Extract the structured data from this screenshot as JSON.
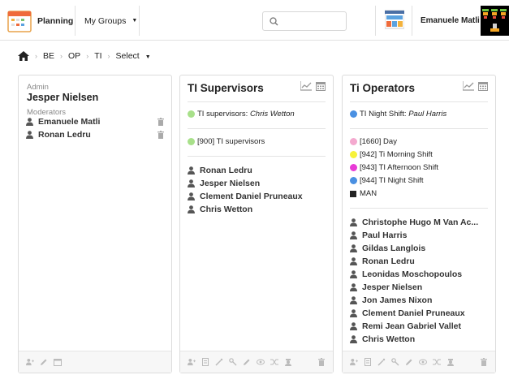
{
  "topbar": {
    "app_name": "Planning",
    "groups_label": "My Groups",
    "search_placeholder": "",
    "user_name": "Emanuele Matli"
  },
  "breadcrumb": {
    "items": [
      "BE",
      "OP",
      "TI"
    ],
    "select_label": "Select"
  },
  "admin_panel": {
    "admin_label": "Admin",
    "admin_name": "Jesper Nielsen",
    "moderators_label": "Moderators",
    "moderators": [
      "Emanuele Matli",
      "Ronan Ledru"
    ]
  },
  "supervisors_panel": {
    "title": "TI Supervisors",
    "lead_prefix": "TI supervisors: ",
    "lead_name": "Chris Wetton",
    "shift": "[900] TI supervisors",
    "members": [
      "Ronan Ledru",
      "Jesper Nielsen",
      "Clement Daniel Pruneaux",
      "Chris Wetton"
    ]
  },
  "operators_panel": {
    "title": "Ti Operators",
    "lead_prefix": "TI Night Shift: ",
    "lead_name": "Paul Harris",
    "shifts": [
      {
        "label": "[1660] Day",
        "color": "#f4a9cf"
      },
      {
        "label": "[942] Ti Morning Shift",
        "color": "#f7f23a"
      },
      {
        "label": "[943] TI Afternoon Shift",
        "color": "#e83ad6"
      },
      {
        "label": "[944] TI Night Shift",
        "color": "#4a90e2"
      }
    ],
    "extra": "MAN",
    "members": [
      "Christophe Hugo M Van Ac...",
      "Paul Harris",
      "Gildas Langlois",
      "Ronan Ledru",
      "Leonidas Moschopoulos",
      "Jesper Nielsen",
      "Jon James Nixon",
      "Clement Daniel Pruneaux",
      "Remi Jean Gabriel Vallet",
      "Chris Wetton"
    ]
  },
  "colors": {
    "supervisors_dot": "#a8e08a",
    "operators_dot": "#4a90e2"
  }
}
